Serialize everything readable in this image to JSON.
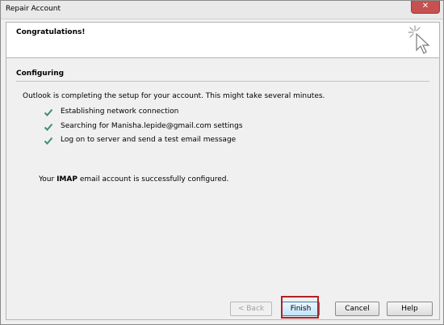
{
  "window": {
    "title": "Repair Account"
  },
  "header": {
    "title": "Congratulations!",
    "icon": "cursor-click-icon"
  },
  "section": {
    "title": "Configuring"
  },
  "intro": "Outlook is completing the setup for your account. This might take several minutes.",
  "steps": [
    {
      "label": "Establishing network connection",
      "icon": "check-icon",
      "status": "done"
    },
    {
      "label": "Searching for Manisha.lepide@gmail.com settings",
      "icon": "check-icon",
      "status": "done"
    },
    {
      "label": "Log on to server and send a test email message",
      "icon": "check-icon",
      "status": "done"
    }
  ],
  "success": {
    "prefix": "Your ",
    "emphasis": "IMAP",
    "suffix": " email account is successfully configured."
  },
  "buttons": {
    "back": "< Back",
    "finish": "Finish",
    "cancel": "Cancel",
    "help": "Help"
  },
  "colors": {
    "check": "#3f8f6e",
    "highlight": "#b22222",
    "close": "#c75050"
  }
}
